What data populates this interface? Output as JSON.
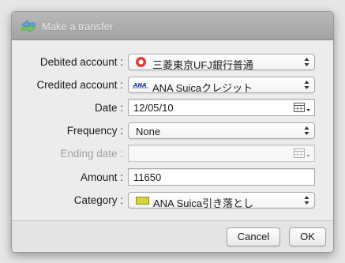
{
  "window": {
    "title": "Make a transfer"
  },
  "form": {
    "debited": {
      "label": "Debited account :",
      "value": "三菱東京UFJ銀行普通",
      "icon": "bank-logo-icon"
    },
    "credited": {
      "label": "Credited account :",
      "value": "ANA Suicaクレジット",
      "icon": "ana-logo-icon"
    },
    "date": {
      "label": "Date :",
      "value": "12/05/10"
    },
    "frequency": {
      "label": "Frequency :",
      "value": "None"
    },
    "ending_date": {
      "label": "Ending date :",
      "value": ""
    },
    "amount": {
      "label": "Amount :",
      "value": "11650"
    },
    "category": {
      "label": "Category :",
      "value": "ANA Suica引き落とし",
      "color": "#d5d53a"
    }
  },
  "buttons": {
    "cancel": "Cancel",
    "ok": "OK"
  }
}
